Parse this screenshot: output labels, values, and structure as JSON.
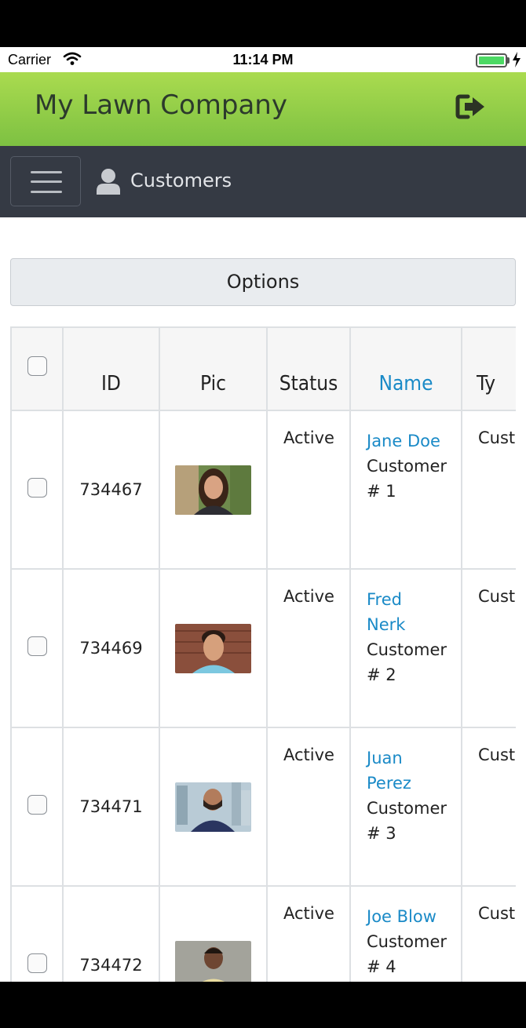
{
  "status_bar": {
    "carrier": "Carrier",
    "time": "11:14 PM"
  },
  "header": {
    "title": "My Lawn Company"
  },
  "nav": {
    "title": "Customers"
  },
  "options": {
    "label": "Options"
  },
  "table": {
    "columns": [
      "ID",
      "Pic",
      "Status",
      "Name",
      "Ty"
    ],
    "rows": [
      {
        "id": "734467",
        "status": "Active",
        "first": "Jane Doe",
        "second": "",
        "line2": "Customer",
        "line3": "# 1",
        "type": "Custo"
      },
      {
        "id": "734469",
        "status": "Active",
        "first": "Fred",
        "second": "Nerk",
        "line2": "Customer",
        "line3": "# 2",
        "type": "Custo"
      },
      {
        "id": "734471",
        "status": "Active",
        "first": "Juan",
        "second": "Perez",
        "line2": "Customer",
        "line3": "# 3",
        "type": "Custo"
      },
      {
        "id": "734472",
        "status": "Active",
        "first": "Joe Blow",
        "second": "",
        "line2": "Customer",
        "line3": "# 4",
        "type": "Custo"
      }
    ]
  },
  "colors": {
    "header_green": "#7dc142",
    "nav_dark": "#353a44",
    "link_blue": "#1a8ac7"
  },
  "icons": [
    "wifi-icon",
    "battery-icon",
    "charging-bolt-icon",
    "logout-icon",
    "hamburger-menu-icon",
    "user-icon"
  ]
}
